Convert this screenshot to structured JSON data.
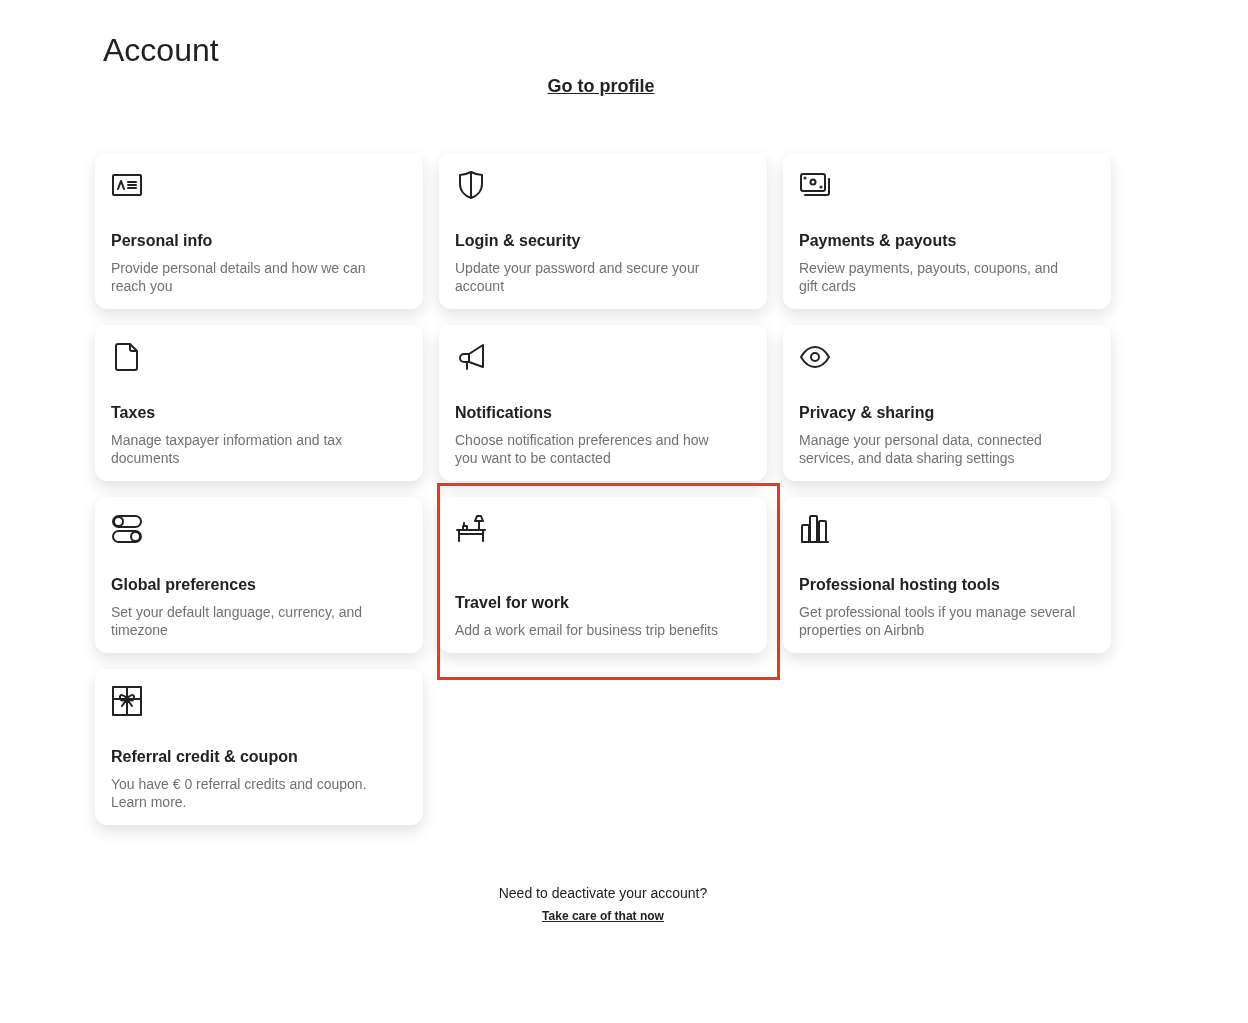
{
  "page_title": "Account",
  "profile_link": "Go to profile",
  "cards": [
    {
      "title": "Personal info",
      "description": "Provide personal details and how we can reach you",
      "highlighted": false
    },
    {
      "title": "Login & security",
      "description": "Update your password and secure your account",
      "highlighted": false
    },
    {
      "title": "Payments & payouts",
      "description": "Review payments, payouts, coupons, and gift cards",
      "highlighted": false
    },
    {
      "title": "Taxes",
      "description": "Manage taxpayer information and tax documents",
      "highlighted": false
    },
    {
      "title": "Notifications",
      "description": "Choose notification preferences and how you want to be contacted",
      "highlighted": false
    },
    {
      "title": "Privacy & sharing",
      "description": "Manage your personal data, connected services, and data sharing settings",
      "highlighted": false
    },
    {
      "title": "Global preferences",
      "description": "Set your default language, currency, and timezone",
      "highlighted": false
    },
    {
      "title": "Travel for work",
      "description": "Add a work email for business trip benefits",
      "highlighted": true
    },
    {
      "title": "Professional hosting tools",
      "description": "Get professional tools if you manage several properties on Airbnb",
      "highlighted": false
    },
    {
      "title": "Referral credit & coupon",
      "description": "You have € 0 referral credits and coupon. Learn more.",
      "highlighted": false
    }
  ],
  "footer": {
    "question": "Need to deactivate your account?",
    "link": "Take care of that now"
  }
}
